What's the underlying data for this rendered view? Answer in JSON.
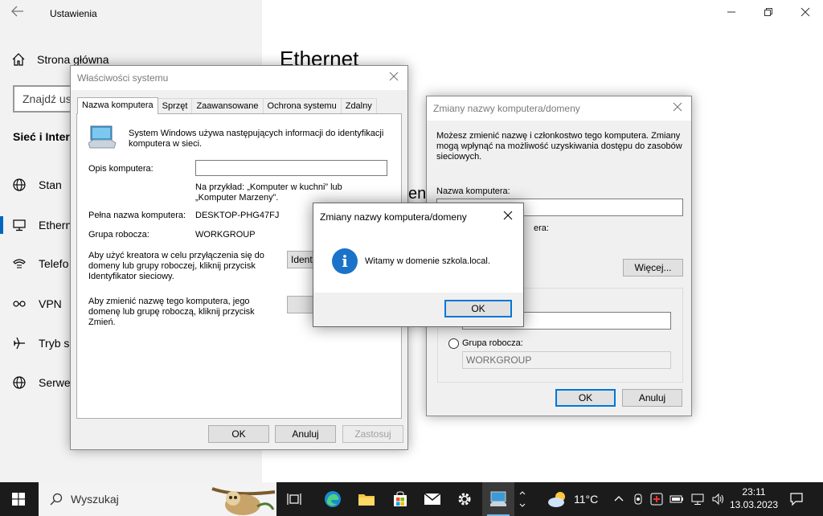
{
  "settings": {
    "title": "Ustawienia",
    "home": "Strona główna",
    "find_placeholder": "Znajdź us",
    "section": "Sieć i Intern",
    "page_title": "Ethernet",
    "partial_text": "en",
    "nav": [
      {
        "label": "Stan",
        "icon": "globe-icon"
      },
      {
        "label": "Ethern",
        "icon": "monitor-icon"
      },
      {
        "label": "Telefo",
        "icon": "dialup-icon"
      },
      {
        "label": "VPN",
        "icon": "vpn-icon"
      },
      {
        "label": "Tryb sa",
        "icon": "airplane-icon"
      },
      {
        "label": "Serwe",
        "icon": "proxy-globe-icon"
      }
    ]
  },
  "sysprops": {
    "title": "Właściwości systemu",
    "tabs": [
      "Nazwa komputera",
      "Sprzęt",
      "Zaawansowane",
      "Ochrona systemu",
      "Zdalny"
    ],
    "intro": "System Windows używa następujących informacji do identyfikacji komputera w sieci.",
    "desc_label": "Opis komputera:",
    "desc_value": "",
    "example": "Na przykład: „Komputer w kuchni” lub „Komputer Marzeny”.",
    "fullname_label": "Pełna nazwa komputera:",
    "fullname_value": "DESKTOP-PHG47FJ",
    "workgroup_label": "Grupa robocza:",
    "workgroup_value": "WORKGROUP",
    "wizard_text": "Aby użyć kreatora w celu przyłączenia się do domeny lub grupy roboczej, kliknij przycisk Identyfikator sieciowy.",
    "network_id_button": "Identy",
    "rename_text": "Aby zmienić nazwę tego komputera, jego domenę lub grupę roboczą, kliknij przycisk Zmień.",
    "change_button": "",
    "ok": "OK",
    "cancel": "Anuluj",
    "apply": "Zastosuj"
  },
  "rename": {
    "title": "Zmiany nazwy komputera/domeny",
    "intro": "Możesz zmienić nazwę i członkostwo tego komputera. Zmiany mogą wpłynąć na możliwość uzyskiwania dostępu do zasobów sieciowych.",
    "name_label": "Nazwa komputera:",
    "name_value": "",
    "partial_label": "era:",
    "more_button": "Więcej...",
    "domain_value": "",
    "workgroup_label": "Grupa robocza:",
    "workgroup_value": "WORKGROUP",
    "ok": "OK",
    "cancel": "Anuluj"
  },
  "welcome": {
    "title": "Zmiany nazwy komputera/domeny",
    "message": "Witamy w domenie szkola.local.",
    "icon": "info-icon",
    "ok": "OK"
  },
  "taskbar": {
    "search_placeholder": "Wyszukaj",
    "weather_temp": "11°C",
    "time": "23:11",
    "date": "13.03.2023"
  }
}
